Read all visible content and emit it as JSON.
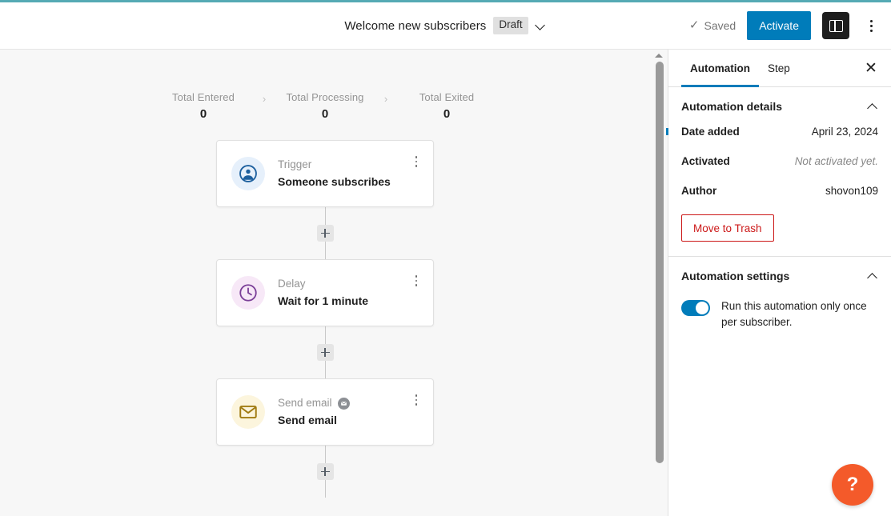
{
  "topbar": {
    "title": "Welcome new subscribers",
    "status_chip": "Draft",
    "status_caret": "chevron-down-icon",
    "saved_label": "Saved",
    "saved_check": "✓",
    "activate_label": "Activate",
    "panel_toggle_icon": "sidebar-panel-icon",
    "more_icon": "kebab-menu-icon"
  },
  "stats": [
    {
      "label": "Total Entered",
      "value": "0"
    },
    {
      "label": "Total Processing",
      "value": "0"
    },
    {
      "label": "Total Exited",
      "value": "0"
    }
  ],
  "stat_separator": "›",
  "flow": {
    "add_label": "+",
    "steps": [
      {
        "kicker": "Trigger",
        "title": "Someone subscribes",
        "icon": "account-circle-icon",
        "icon_theme": "trigger",
        "badge": null
      },
      {
        "kicker": "Delay",
        "title": "Wait for 1 minute",
        "icon": "clock-icon",
        "icon_theme": "delay",
        "badge": null
      },
      {
        "kicker": "Send email",
        "title": "Send email",
        "icon": "envelope-icon",
        "icon_theme": "email",
        "badge": "email-status-badge-icon"
      }
    ]
  },
  "sidebar": {
    "tabs": [
      {
        "label": "Automation",
        "active": true
      },
      {
        "label": "Step",
        "active": false
      }
    ],
    "close_icon": "close-icon",
    "details": {
      "section_title": "Automation details",
      "collapse_icon": "chevron-up-icon",
      "rows": [
        {
          "label": "Date added",
          "value": "April 23, 2024",
          "muted": false
        },
        {
          "label": "Activated",
          "value": "Not activated yet.",
          "muted": true
        },
        {
          "label": "Author",
          "value": "shovon109",
          "muted": false
        }
      ],
      "trash_label": "Move to Trash"
    },
    "settings": {
      "section_title": "Automation settings",
      "collapse_icon": "chevron-up-icon",
      "toggle_on": true,
      "toggle_text": "Run this automation only once per subscriber."
    }
  },
  "help": {
    "label": "?",
    "icon": "help-question-icon"
  },
  "colors": {
    "accent_strip": "#55aab4",
    "primary": "#007cba",
    "danger": "#cc1818",
    "help": "#f45a2a",
    "canvas_bg": "#f7f7f7"
  }
}
